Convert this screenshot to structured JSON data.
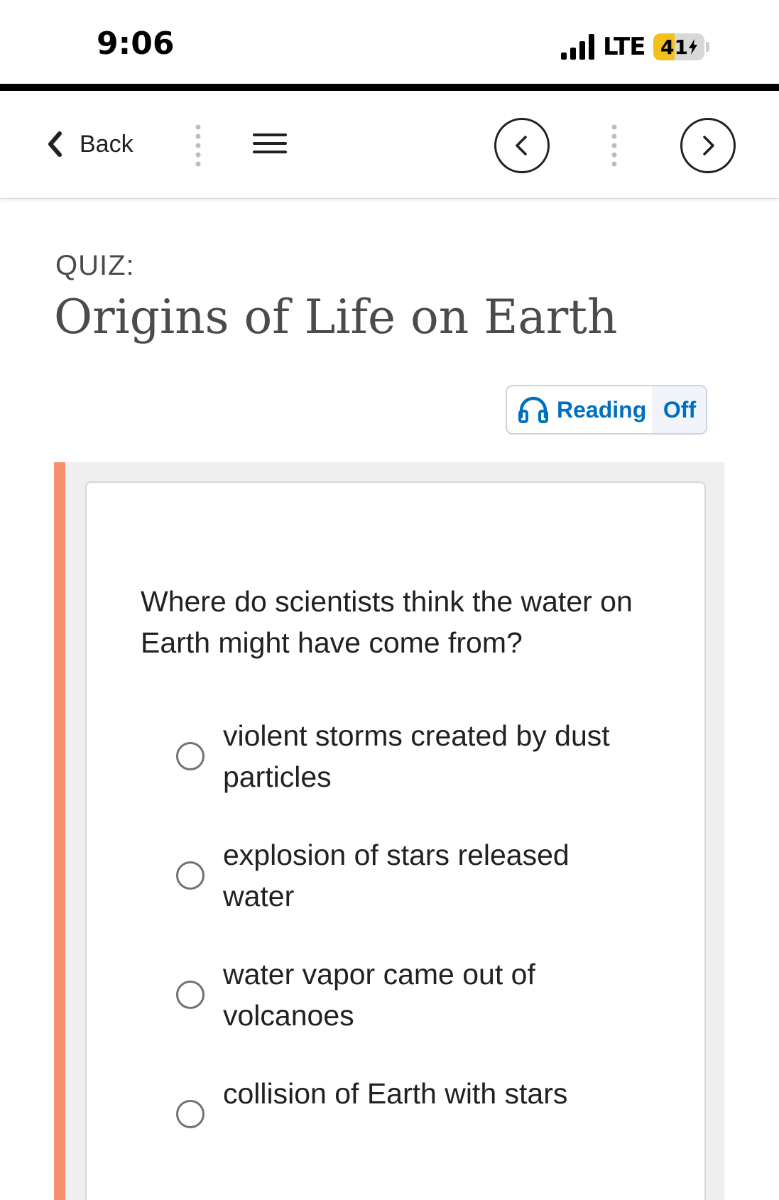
{
  "status_bar": {
    "time": "9:06",
    "network": "LTE",
    "battery": "41",
    "battery_level_percent": 41,
    "battery_color": "#f2c21b",
    "charging_icon": "bolt-icon"
  },
  "nav": {
    "back_label": "Back",
    "back_icon": "chevron-left-icon",
    "menu_icon": "hamburger-menu-icon",
    "prev_icon": "circle-chevron-left-icon",
    "next_icon": "circle-chevron-right-icon"
  },
  "header": {
    "kicker": "QUIZ:",
    "title": "Origins of Life on Earth"
  },
  "reading": {
    "icon": "headphones-icon",
    "label": "Reading",
    "state": "Off",
    "accent_color": "#006fbf"
  },
  "question": {
    "accent_color": "#f7906f",
    "text": "Where do scientists think the water on Earth might have come from?",
    "options": [
      {
        "label": "violent storms created by dust particles",
        "selected": false
      },
      {
        "label": "explosion of stars released water",
        "selected": false
      },
      {
        "label": "water vapor came out of volcanoes",
        "selected": false
      },
      {
        "label": "collision of Earth with stars",
        "selected": false
      }
    ]
  }
}
